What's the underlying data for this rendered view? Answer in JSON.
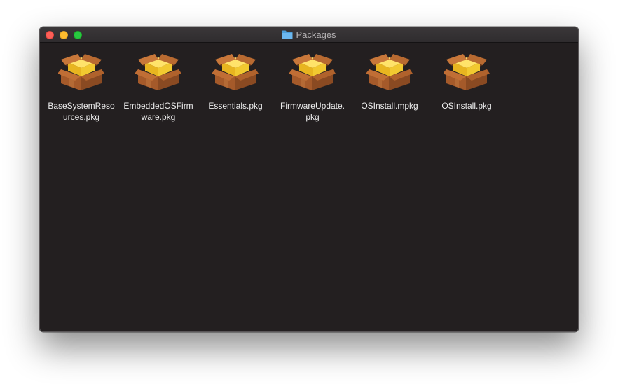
{
  "window": {
    "title": "Packages",
    "title_icon": "folder-icon",
    "background_color": "#231f20",
    "traffic_lights": {
      "close_color": "#fd5f57",
      "minimize_color": "#febc2e",
      "zoom_color": "#28c840"
    }
  },
  "files": [
    {
      "label_line1": "BaseSystemReso",
      "label_line2": "urces.pkg",
      "icon": "package-icon"
    },
    {
      "label_line1": "EmbeddedOSFirm",
      "label_line2": "ware.pkg",
      "icon": "package-icon"
    },
    {
      "label_line1": "Essentials.pkg",
      "label_line2": "",
      "icon": "package-icon"
    },
    {
      "label_line1": "FirmwareUpdate.",
      "label_line2": "pkg",
      "icon": "package-icon"
    },
    {
      "label_line1": "OSInstall.mpkg",
      "label_line2": "",
      "icon": "package-icon"
    },
    {
      "label_line1": "OSInstall.pkg",
      "label_line2": "",
      "icon": "package-icon"
    }
  ]
}
